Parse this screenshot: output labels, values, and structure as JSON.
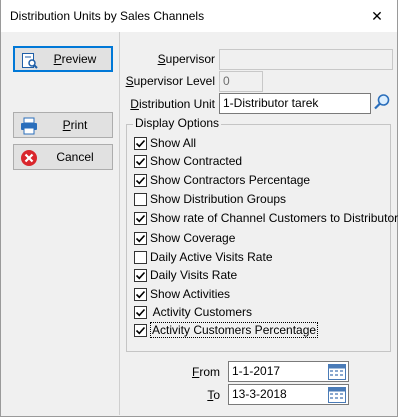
{
  "window": {
    "title": "Distribution Units by Sales Channels",
    "close_glyph": "✕"
  },
  "buttons": {
    "preview": {
      "pre": "",
      "u": "P",
      "post": "review"
    },
    "print": {
      "pre": "",
      "u": "P",
      "post": "rint"
    },
    "cancel": {
      "pre": "Cancel",
      "u": "",
      "post": ""
    }
  },
  "fields": {
    "supervisor": {
      "pre": "",
      "u": "S",
      "post": "upervisor",
      "value": ""
    },
    "supervisor_level": {
      "pre": "",
      "u": "S",
      "post": "upervisor Level",
      "value": "0"
    },
    "distribution_unit": {
      "pre": "",
      "u": "D",
      "post": "istribution Unit",
      "value": "1-Distributor tarek"
    }
  },
  "display_options": {
    "title": "Display Options",
    "items": [
      {
        "label": "Show All",
        "checked": true
      },
      {
        "label": "Show Contracted",
        "checked": true
      },
      {
        "label": "Show Contractors Percentage",
        "checked": true
      },
      {
        "label": "Show Distribution Groups",
        "checked": false
      },
      {
        "label": "Show rate of Channel Customers to Distributor's",
        "checked": true
      },
      {
        "label": "Show Coverage",
        "checked": true
      },
      {
        "label": "Daily Active Visits Rate",
        "checked": false
      },
      {
        "label": "Daily Visits Rate",
        "checked": true
      },
      {
        "label": "Show Activities",
        "checked": true
      },
      {
        "label": " Activity Customers",
        "checked": true
      },
      {
        "label": "Activity Customers Percentage",
        "checked": true
      }
    ]
  },
  "dates": {
    "from": {
      "pre": "",
      "u": "F",
      "post": "rom",
      "value": "1-1-2017"
    },
    "to": {
      "pre": "",
      "u": "T",
      "post": "o",
      "value": "13-3-2018"
    }
  },
  "colors": {
    "accent": "#0078d7",
    "cancel_red": "#d9262c"
  }
}
